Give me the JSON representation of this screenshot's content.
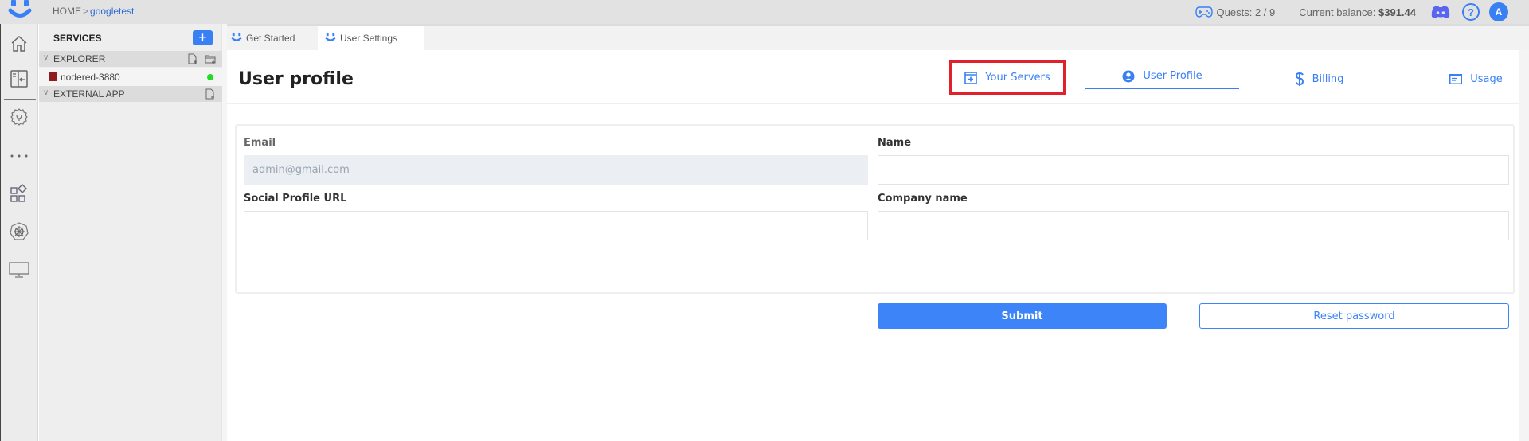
{
  "topbar": {
    "breadcrumb": {
      "home": "HOME",
      "separator": ">",
      "current": "googletest"
    },
    "quests": "Quests: 2 / 9",
    "balance_label": "Current balance:",
    "balance_value": "$391.44",
    "help_glyph": "?",
    "avatar_initial": "A",
    "icons": [
      "app-logo-icon",
      "gamepad-icon",
      "discord-icon",
      "help-icon"
    ]
  },
  "iconrail": {
    "items": [
      {
        "name": "home-icon"
      },
      {
        "name": "collapse-panel-icon"
      },
      {
        "name": "settings-gear-icon"
      },
      {
        "name": "more-icon"
      },
      {
        "name": "apps-icon"
      },
      {
        "name": "kubernetes-icon"
      },
      {
        "name": "monitor-icon"
      }
    ]
  },
  "sidebar": {
    "title": "SERVICES",
    "add_glyph": "+",
    "sections": [
      {
        "label": "EXPLORER",
        "actions": [
          "new-file-icon",
          "new-folder-icon"
        ]
      },
      {
        "label": "EXTERNAL APP",
        "actions": [
          "new-file-icon"
        ]
      }
    ],
    "items": [
      {
        "label": "nodered-3880",
        "status": "online",
        "status_color": "#22dd22"
      }
    ]
  },
  "tabs": [
    {
      "label": "Get Started",
      "active": false
    },
    {
      "label": "User Settings",
      "active": true
    }
  ],
  "main": {
    "title": "User profile",
    "nav": [
      {
        "label": "Your Servers",
        "icon": "servers-icon",
        "highlighted": true
      },
      {
        "label": "User Profile",
        "icon": "user-circle-icon",
        "active": true
      },
      {
        "label": "Billing",
        "icon": "dollar-icon"
      },
      {
        "label": "Usage",
        "icon": "usage-icon"
      }
    ],
    "form": {
      "email": {
        "label": "Email",
        "value": "admin@gmail.com",
        "disabled": true
      },
      "name": {
        "label": "Name",
        "value": ""
      },
      "social": {
        "label": "Social Profile URL",
        "value": ""
      },
      "company": {
        "label": "Company name",
        "value": ""
      },
      "submit_label": "Submit",
      "reset_label": "Reset password"
    }
  },
  "colors": {
    "accent": "#3c84f7",
    "highlight": "#e0202a",
    "online": "#22dd22"
  }
}
